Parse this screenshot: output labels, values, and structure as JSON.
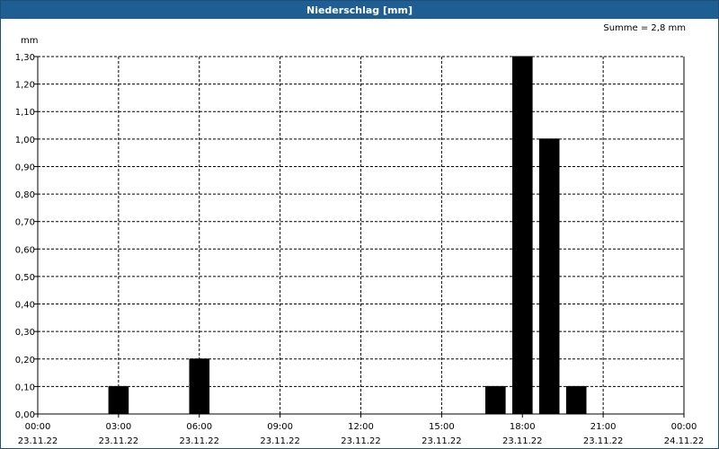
{
  "window": {
    "title": "Niederschlag [mm]"
  },
  "annotation": {
    "sum": "Summe = 2,8 mm"
  },
  "chart_data": {
    "type": "bar",
    "title": "Niederschlag [mm]",
    "ylabel": "mm",
    "xlabel": "",
    "ylim": [
      0,
      1.3
    ],
    "y_ticks": [
      "0,00",
      "0,10",
      "0,20",
      "0,30",
      "0,40",
      "0,50",
      "0,60",
      "0,70",
      "0,80",
      "0,90",
      "1,00",
      "1,10",
      "1,20",
      "1,30"
    ],
    "x_ticks": [
      {
        "time": "00:00",
        "date": "23.11.22"
      },
      {
        "time": "03:00",
        "date": "23.11.22"
      },
      {
        "time": "06:00",
        "date": "23.11.22"
      },
      {
        "time": "09:00",
        "date": "23.11.22"
      },
      {
        "time": "12:00",
        "date": "23.11.22"
      },
      {
        "time": "15:00",
        "date": "23.11.22"
      },
      {
        "time": "18:00",
        "date": "23.11.22"
      },
      {
        "time": "21:00",
        "date": "23.11.22"
      },
      {
        "time": "00:00",
        "date": "24.11.22"
      }
    ],
    "x_range": [
      "2022-11-23 00:00",
      "2022-11-24 00:00"
    ],
    "bar_interval": "1h",
    "bars": [
      {
        "time": "2022-11-23 03:00",
        "value": 0.1
      },
      {
        "time": "2022-11-23 06:00",
        "value": 0.2
      },
      {
        "time": "2022-11-23 17:00",
        "value": 0.1
      },
      {
        "time": "2022-11-23 18:00",
        "value": 1.3
      },
      {
        "time": "2022-11-23 19:00",
        "value": 1.0
      },
      {
        "time": "2022-11-23 20:00",
        "value": 0.1
      }
    ],
    "grid": true,
    "colors": {
      "bar": "#000000",
      "grid": "#000000",
      "titlebar": "#1f5e92"
    }
  }
}
